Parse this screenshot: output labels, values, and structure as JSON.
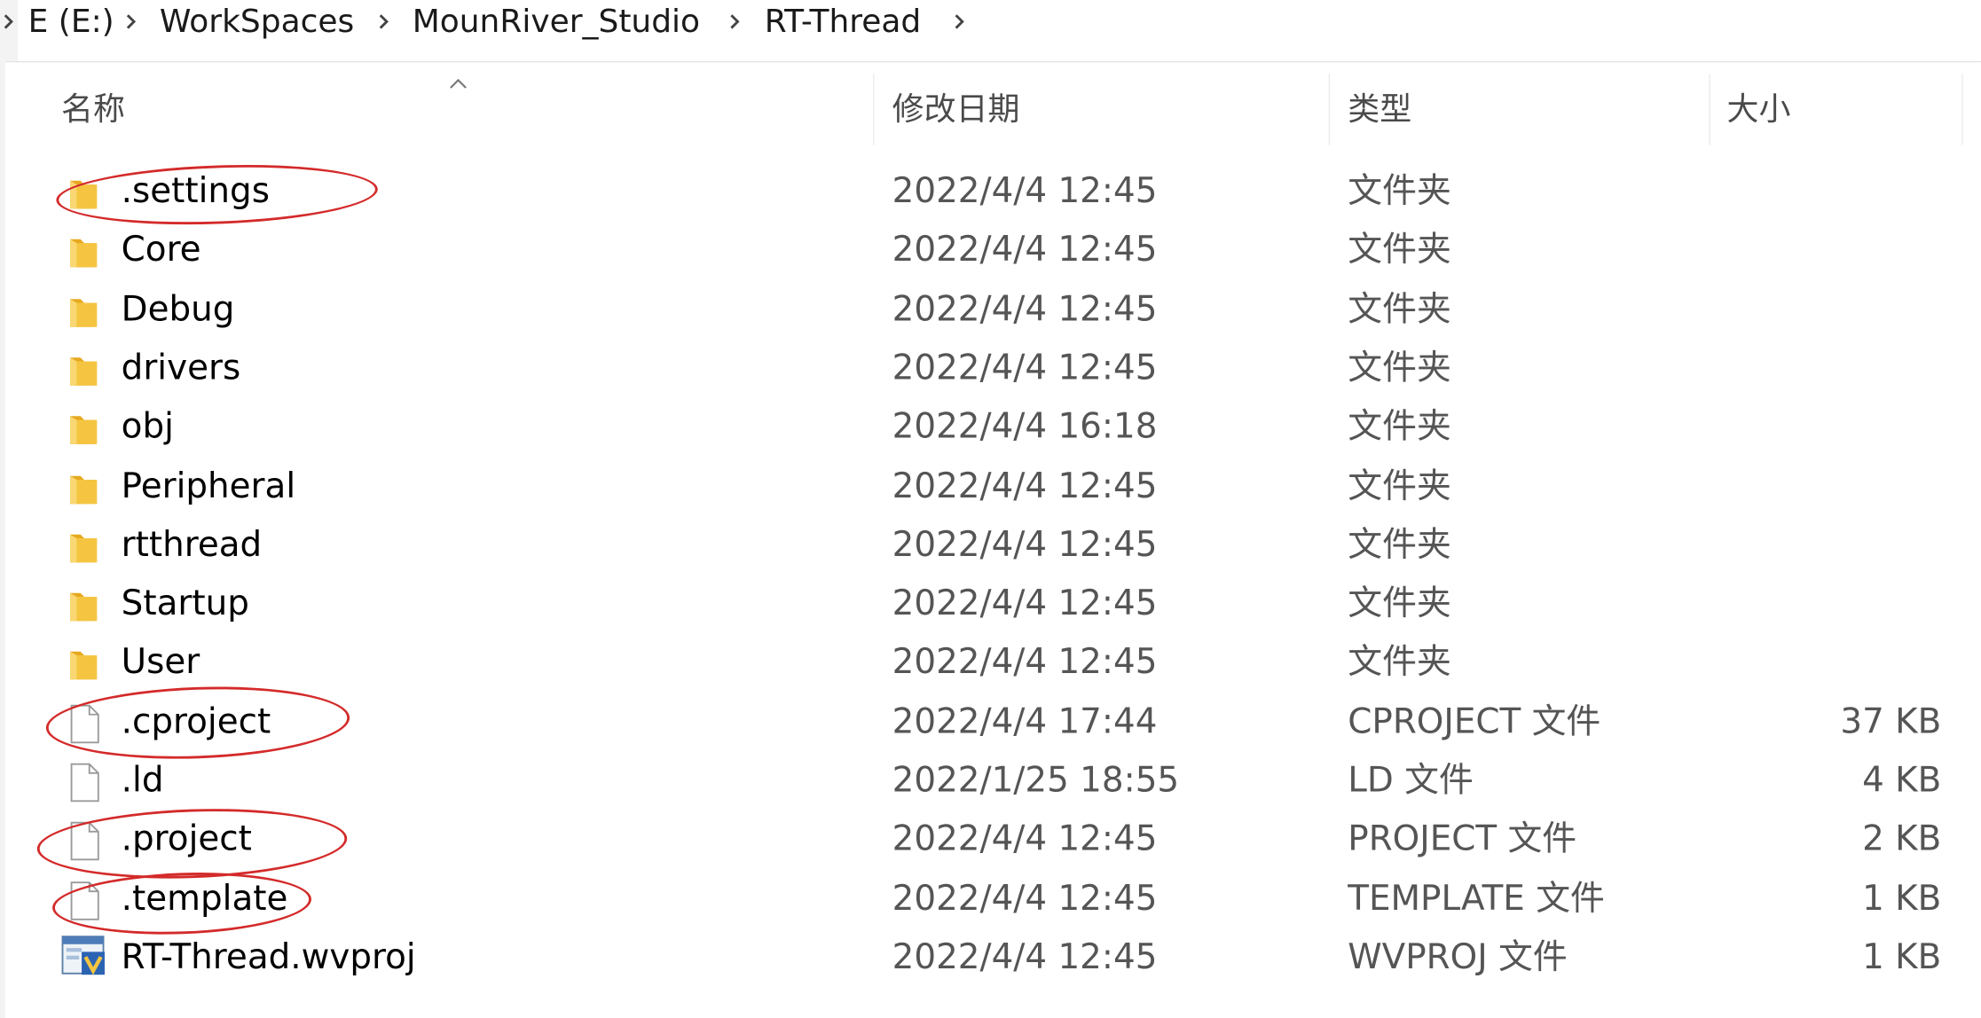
{
  "breadcrumb": {
    "items": [
      "E (E:)",
      "WorkSpaces",
      "MounRiver_Studio",
      "RT-Thread"
    ]
  },
  "columns": {
    "name": "名称",
    "date": "修改日期",
    "type": "类型",
    "size": "大小"
  },
  "files": [
    {
      "name": ".settings",
      "date": "2022/4/4 12:45",
      "type": "文件夹",
      "size": "",
      "icon": "folder-icon"
    },
    {
      "name": "Core",
      "date": "2022/4/4 12:45",
      "type": "文件夹",
      "size": "",
      "icon": "folder-icon"
    },
    {
      "name": "Debug",
      "date": "2022/4/4 12:45",
      "type": "文件夹",
      "size": "",
      "icon": "folder-icon"
    },
    {
      "name": "drivers",
      "date": "2022/4/4 12:45",
      "type": "文件夹",
      "size": "",
      "icon": "folder-icon"
    },
    {
      "name": "obj",
      "date": "2022/4/4 16:18",
      "type": "文件夹",
      "size": "",
      "icon": "folder-icon"
    },
    {
      "name": "Peripheral",
      "date": "2022/4/4 12:45",
      "type": "文件夹",
      "size": "",
      "icon": "folder-icon"
    },
    {
      "name": "rtthread",
      "date": "2022/4/4 12:45",
      "type": "文件夹",
      "size": "",
      "icon": "folder-icon"
    },
    {
      "name": "Startup",
      "date": "2022/4/4 12:45",
      "type": "文件夹",
      "size": "",
      "icon": "folder-icon"
    },
    {
      "name": "User",
      "date": "2022/4/4 12:45",
      "type": "文件夹",
      "size": "",
      "icon": "folder-icon"
    },
    {
      "name": ".cproject",
      "date": "2022/4/4 17:44",
      "type": "CPROJECT 文件",
      "size": "37 KB",
      "icon": "file-icon"
    },
    {
      "name": ".ld",
      "date": "2022/1/25 18:55",
      "type": "LD 文件",
      "size": "4 KB",
      "icon": "file-icon"
    },
    {
      "name": ".project",
      "date": "2022/4/4 12:45",
      "type": "PROJECT 文件",
      "size": "2 KB",
      "icon": "file-icon"
    },
    {
      "name": ".template",
      "date": "2022/4/4 12:45",
      "type": "TEMPLATE 文件",
      "size": "1 KB",
      "icon": "file-icon"
    },
    {
      "name": "RT-Thread.wvproj",
      "date": "2022/4/4 12:45",
      "type": "WVPROJ 文件",
      "size": "1 KB",
      "icon": "wvproj-file-icon"
    }
  ],
  "colors": {
    "annotation": "#d42a2a",
    "folder": "#f5c542",
    "folder_shade": "#e6a91f",
    "header_text": "#4a4a4a",
    "detail_text": "#555555"
  }
}
